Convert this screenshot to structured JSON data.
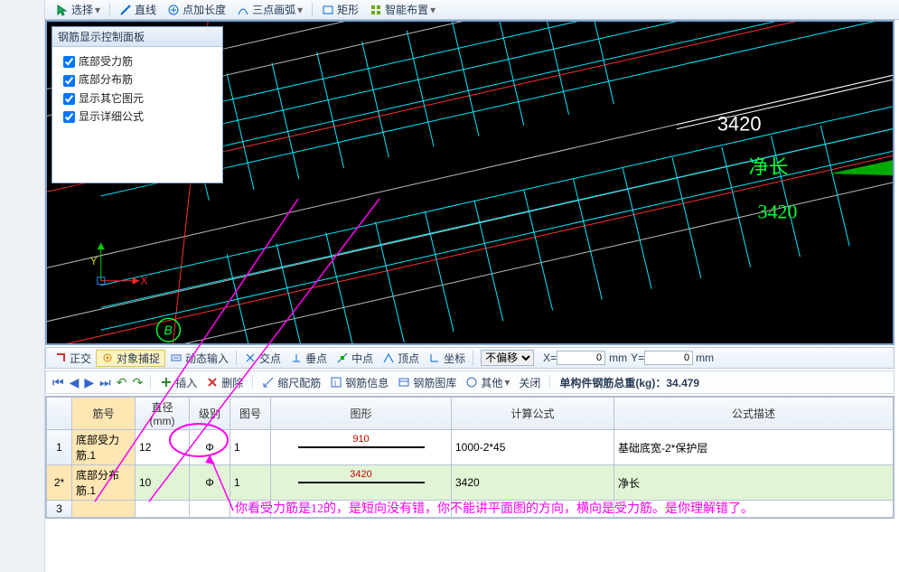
{
  "top_tools": {
    "select": "选择",
    "line": "直线",
    "addlen": "点加长度",
    "arc3": "三点画弧",
    "rect": "矩形",
    "smart": "智能布置"
  },
  "panel": {
    "title": "钢筋显示控制面板",
    "chk1": "底部受力筋",
    "chk2": "底部分布筋",
    "chk3": "显示其它图元",
    "chk4": "显示详细公式"
  },
  "cad": {
    "dim1": "3420",
    "netlen": "净长",
    "netval": "3420",
    "axisY": "Y",
    "axisX": "X",
    "markB": "B"
  },
  "mid": {
    "ortho": "正交",
    "osnap": "对象捕捉",
    "dyninput": "动态输入",
    "intersection": "交点",
    "perp": "垂点",
    "midpoint": "中点",
    "apex": "顶点",
    "ordinate": "坐标",
    "nooffset": "不偏移",
    "Xlabel": "X=",
    "Xval": "0",
    "mm": "mm",
    "Ylabel": "Y=",
    "Yval": "0"
  },
  "nav": {
    "insert": "插入",
    "delete": "删除",
    "scale": "缩尺配筋",
    "info": "钢筋信息",
    "library": "钢筋图库",
    "other": "其他",
    "close": "关闭",
    "weight": "单构件钢筋总重(kg)：34.479"
  },
  "table": {
    "headers": {
      "no": "筋号",
      "dia": "直径(mm)",
      "grade": "级别",
      "shapeNo": "图号",
      "shape": "图形",
      "formula": "计算公式",
      "desc": "公式描述"
    },
    "rows": [
      {
        "idx": "1",
        "name": "底部受力筋.1",
        "dia": "12",
        "grade": "Φ",
        "shapeNo": "1",
        "len": "910",
        "formula": "1000-2*45",
        "desc": "基础底宽-2*保护层"
      },
      {
        "idx": "2*",
        "name": "底部分布筋.1",
        "dia": "10",
        "grade": "Φ",
        "shapeNo": "1",
        "len": "3420",
        "formula": "3420",
        "desc": "净长"
      },
      {
        "idx": "3"
      }
    ]
  },
  "annotation": "你看受力筋是12的，是短向没有错，你不能讲平面图的方向，横向是受力筋。是你理解错了。"
}
